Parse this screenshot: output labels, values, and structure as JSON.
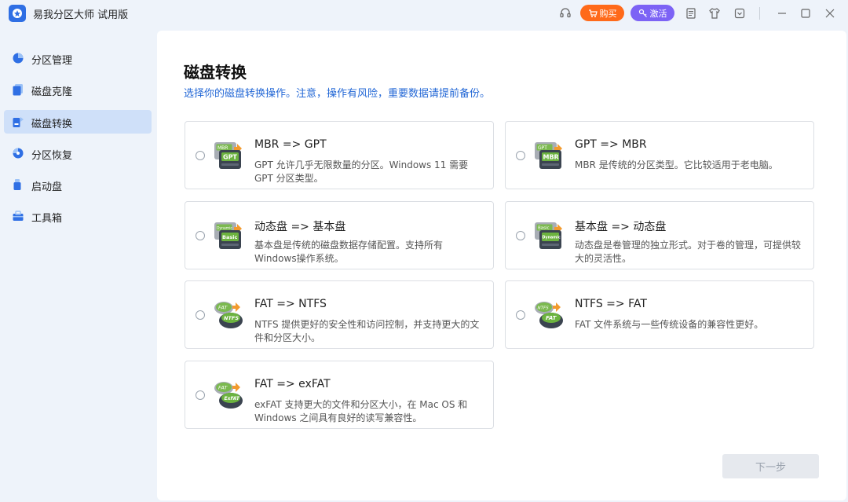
{
  "app": {
    "title": "易我分区大师 试用版"
  },
  "titlebar": {
    "buy_label": "购买",
    "activate_label": "激活",
    "accent_buy": "#ff6a1a",
    "accent_activate": "#7c63f5"
  },
  "sidebar": {
    "items": [
      {
        "label": "分区管理",
        "icon": "partition-pie-icon"
      },
      {
        "label": "磁盘克隆",
        "icon": "disk-clone-icon"
      },
      {
        "label": "磁盘转换",
        "icon": "disk-convert-icon",
        "active": true
      },
      {
        "label": "分区恢复",
        "icon": "partition-recovery-icon"
      },
      {
        "label": "启动盘",
        "icon": "boot-disk-icon"
      },
      {
        "label": "工具箱",
        "icon": "toolbox-icon"
      }
    ]
  },
  "main": {
    "title": "磁盘转换",
    "subtitle": "选择你的磁盘转换操作。注意，操作有风险，重要数据请提前备份。",
    "options": [
      {
        "title": "MBR => GPT",
        "desc": "GPT 允许几乎无限数量的分区。Windows 11 需要GPT 分区类型。",
        "icon_front": "GPT",
        "icon_back": "MBR"
      },
      {
        "title": "GPT => MBR",
        "desc": "MBR 是传统的分区类型。它比较适用于老电脑。",
        "icon_front": "MBR",
        "icon_back": "GPT"
      },
      {
        "title": "动态盘 => 基本盘",
        "desc": "基本盘是传统的磁盘数据存储配置。支持所有Windows操作系统。",
        "icon_front": "Basic",
        "icon_back": "Dynamic"
      },
      {
        "title": "基本盘 => 动态盘",
        "desc": "动态盘是卷管理的独立形式。对于卷的管理，可提供较大的灵活性。",
        "icon_front": "Dynamic",
        "icon_back": "Basic"
      },
      {
        "title": "FAT => NTFS",
        "desc": "NTFS 提供更好的安全性和访问控制，并支持更大的文件和分区大小。",
        "icon_front": "NTFS",
        "icon_back": "FAT"
      },
      {
        "title": "NTFS => FAT",
        "desc": "FAT 文件系统与一些传统设备的兼容性更好。",
        "icon_front": "FAT",
        "icon_back": "NTFS"
      },
      {
        "title": "FAT => exFAT",
        "desc": "exFAT 支持更大的文件和分区大小，在 Mac OS 和Windows 之间具有良好的读写兼容性。",
        "icon_front": "ExFAT",
        "icon_back": "FAT"
      }
    ],
    "next_label": "下一步"
  }
}
